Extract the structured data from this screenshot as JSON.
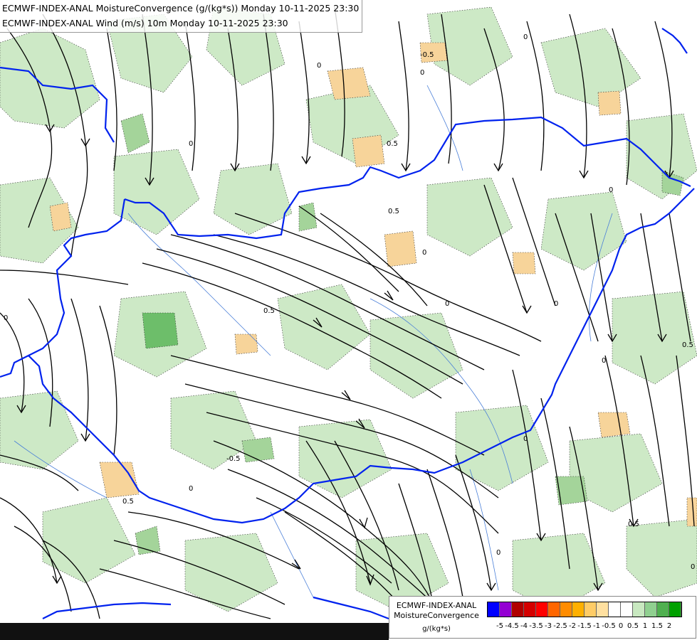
{
  "header": {
    "line1": "ECMWF-INDEX-ANAL MoistureConvergence (g/(kg*s)) Monday 10-11-2025 23:30",
    "line2": "ECMWF-INDEX-ANAL Wind (m/s) 10m Monday 10-11-2025 23:30"
  },
  "legend": {
    "title_line1": "ECMWF-INDEX-ANAL",
    "title_line2": "MoistureConvergence",
    "unit": "g/(kg*s)",
    "colors": [
      "#0000ff",
      "#9400d3",
      "#b00000",
      "#d40000",
      "#ff0000",
      "#ff6600",
      "#ff8c00",
      "#ffb000",
      "#ffcc66",
      "#ffe0a0",
      "#ffffff",
      "#ffffff",
      "#c8e8c0",
      "#90d090",
      "#50b050",
      "#00a000"
    ],
    "ticks": [
      "-5",
      "-4.5",
      "-4",
      "-3.5",
      "-3",
      "-2.5",
      "-2",
      "-1.5",
      "-1",
      "-0.5",
      "0",
      "0.5",
      "1",
      "1.5",
      "2"
    ]
  },
  "map_labels": [
    "0",
    "0",
    "0",
    "0",
    "0",
    "0",
    "0",
    "0",
    "0",
    "0",
    "0",
    "0",
    "0",
    "0",
    "0.5",
    "-0.5",
    "0.5",
    "-0.5",
    "0.5",
    "0.5",
    "0.5",
    "0.5"
  ],
  "colors": {
    "border": "#0022ee",
    "river": "#4a7fd8",
    "streamline": "#000000",
    "green_light": "#cde9c6",
    "green_mid": "#a4d49a",
    "green_dark": "#6dbe6a",
    "orange_light": "#f7d49a"
  }
}
